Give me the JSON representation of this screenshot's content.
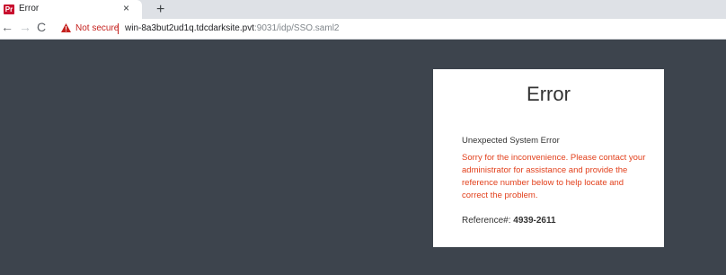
{
  "browser": {
    "tab_title": "Error",
    "tab_favicon_text": "Pr",
    "tab_close": "×",
    "new_tab": "+",
    "nav_back": "←",
    "nav_forward": "→",
    "nav_reload": "C",
    "security_label": "Not secure",
    "url_host": "win-8a3but2ud1q.tdcdarksite.pvt",
    "url_path": ":9031/idp/SSO.saml2"
  },
  "error_card": {
    "title": "Error",
    "subtitle": "Unexpected System Error",
    "message": "Sorry for the inconvenience. Please contact your administrator for assistance and provide the reference number below to help locate and correct the problem.",
    "reference_label": "Reference#:",
    "reference_number": "4939-2611"
  },
  "colors": {
    "background": "#3d444d",
    "card": "#ffffff",
    "message": "#e2401c",
    "not_secure": "#c5221f"
  },
  "icons": {
    "favicon": "app-favicon-icon",
    "warning": "warning-triangle-icon"
  }
}
